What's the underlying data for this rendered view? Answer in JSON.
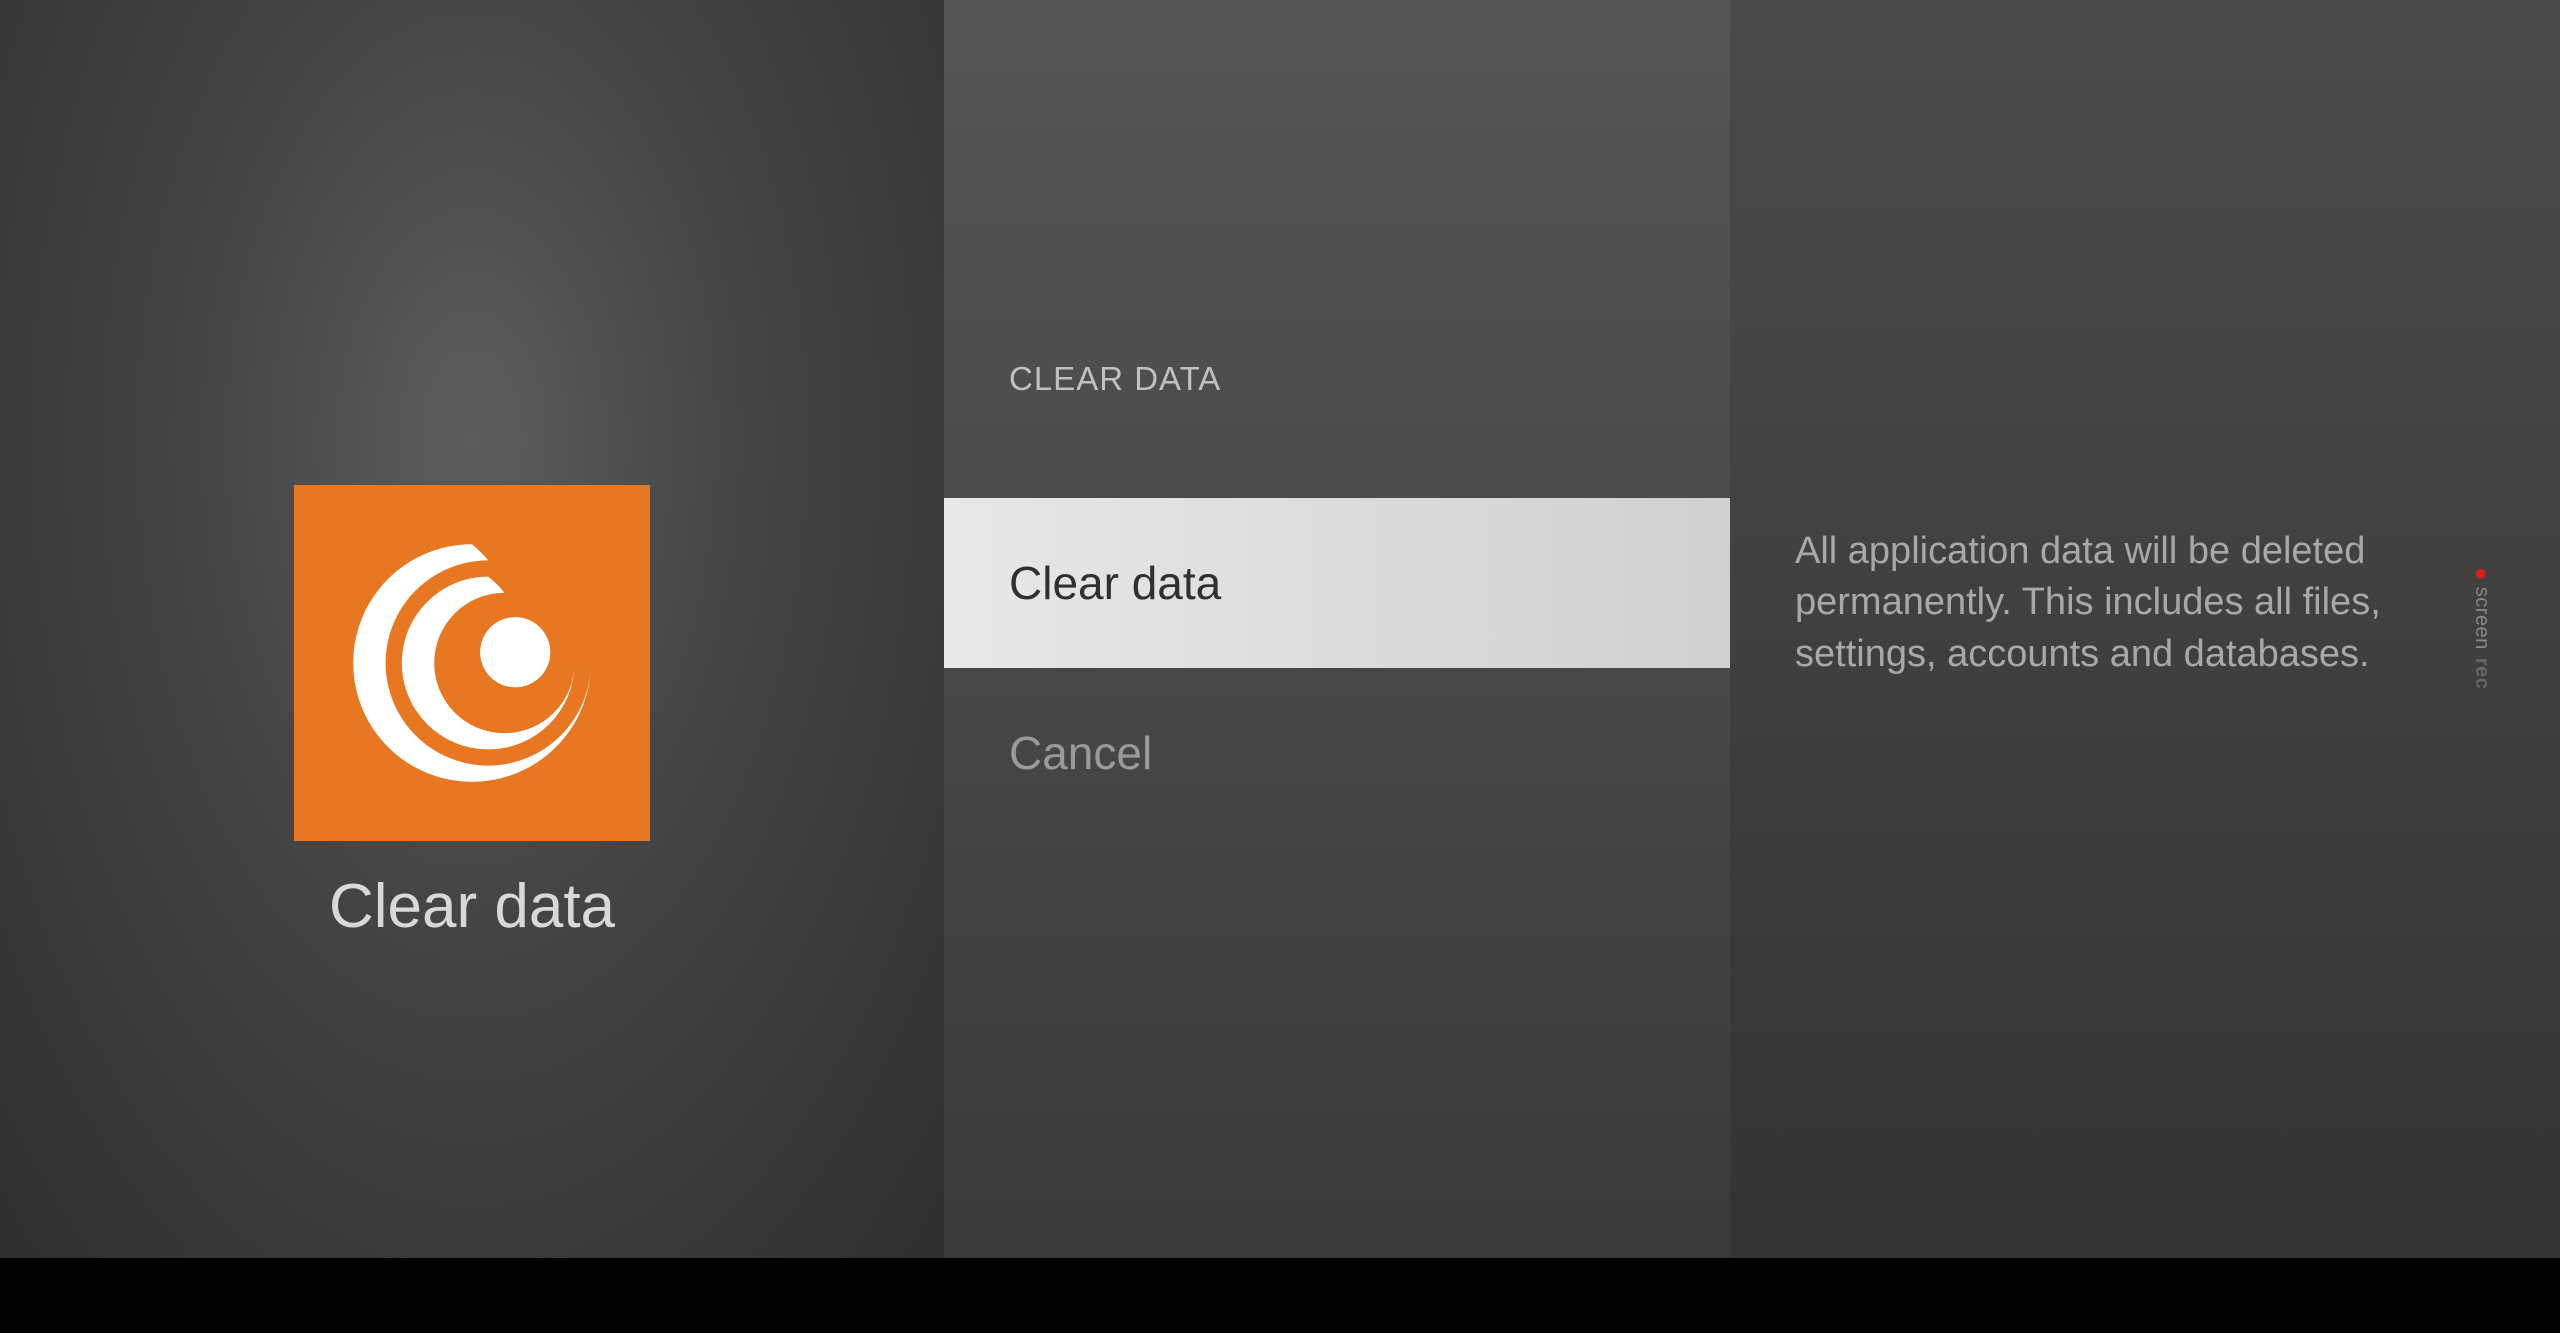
{
  "left": {
    "app_title": "Clear data",
    "icon_color": "#e87722"
  },
  "middle": {
    "header": "CLEAR DATA",
    "options": [
      {
        "label": "Clear data",
        "selected": true
      },
      {
        "label": "Cancel",
        "selected": false
      }
    ]
  },
  "right": {
    "description": "All application data will be deleted permanently. This includes all files, settings, accounts and databases."
  },
  "recorder": {
    "prefix": "screen",
    "suffix": "rec"
  }
}
